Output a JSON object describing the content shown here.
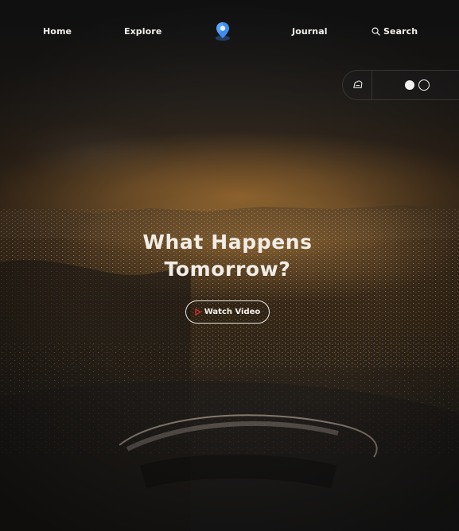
{
  "nav": {
    "items": [
      {
        "label": "Home"
      },
      {
        "label": "Explore"
      },
      {
        "label": "Journal"
      }
    ],
    "search_label": "Search",
    "logo_icon": "map-pin-icon"
  },
  "controls": {
    "weather_icon": "cloud-sun-icon",
    "theme_toggle_icons": [
      "filled-dot",
      "outline-dot"
    ]
  },
  "hero": {
    "headline_line1": "What Happens",
    "headline_line2": "Tomorrow?",
    "cta_label": "Watch Video",
    "cta_icon": "play-icon"
  },
  "colors": {
    "text": "#f1ede6",
    "accent": "#e0312f",
    "logo_blue": "#3d8df0"
  }
}
